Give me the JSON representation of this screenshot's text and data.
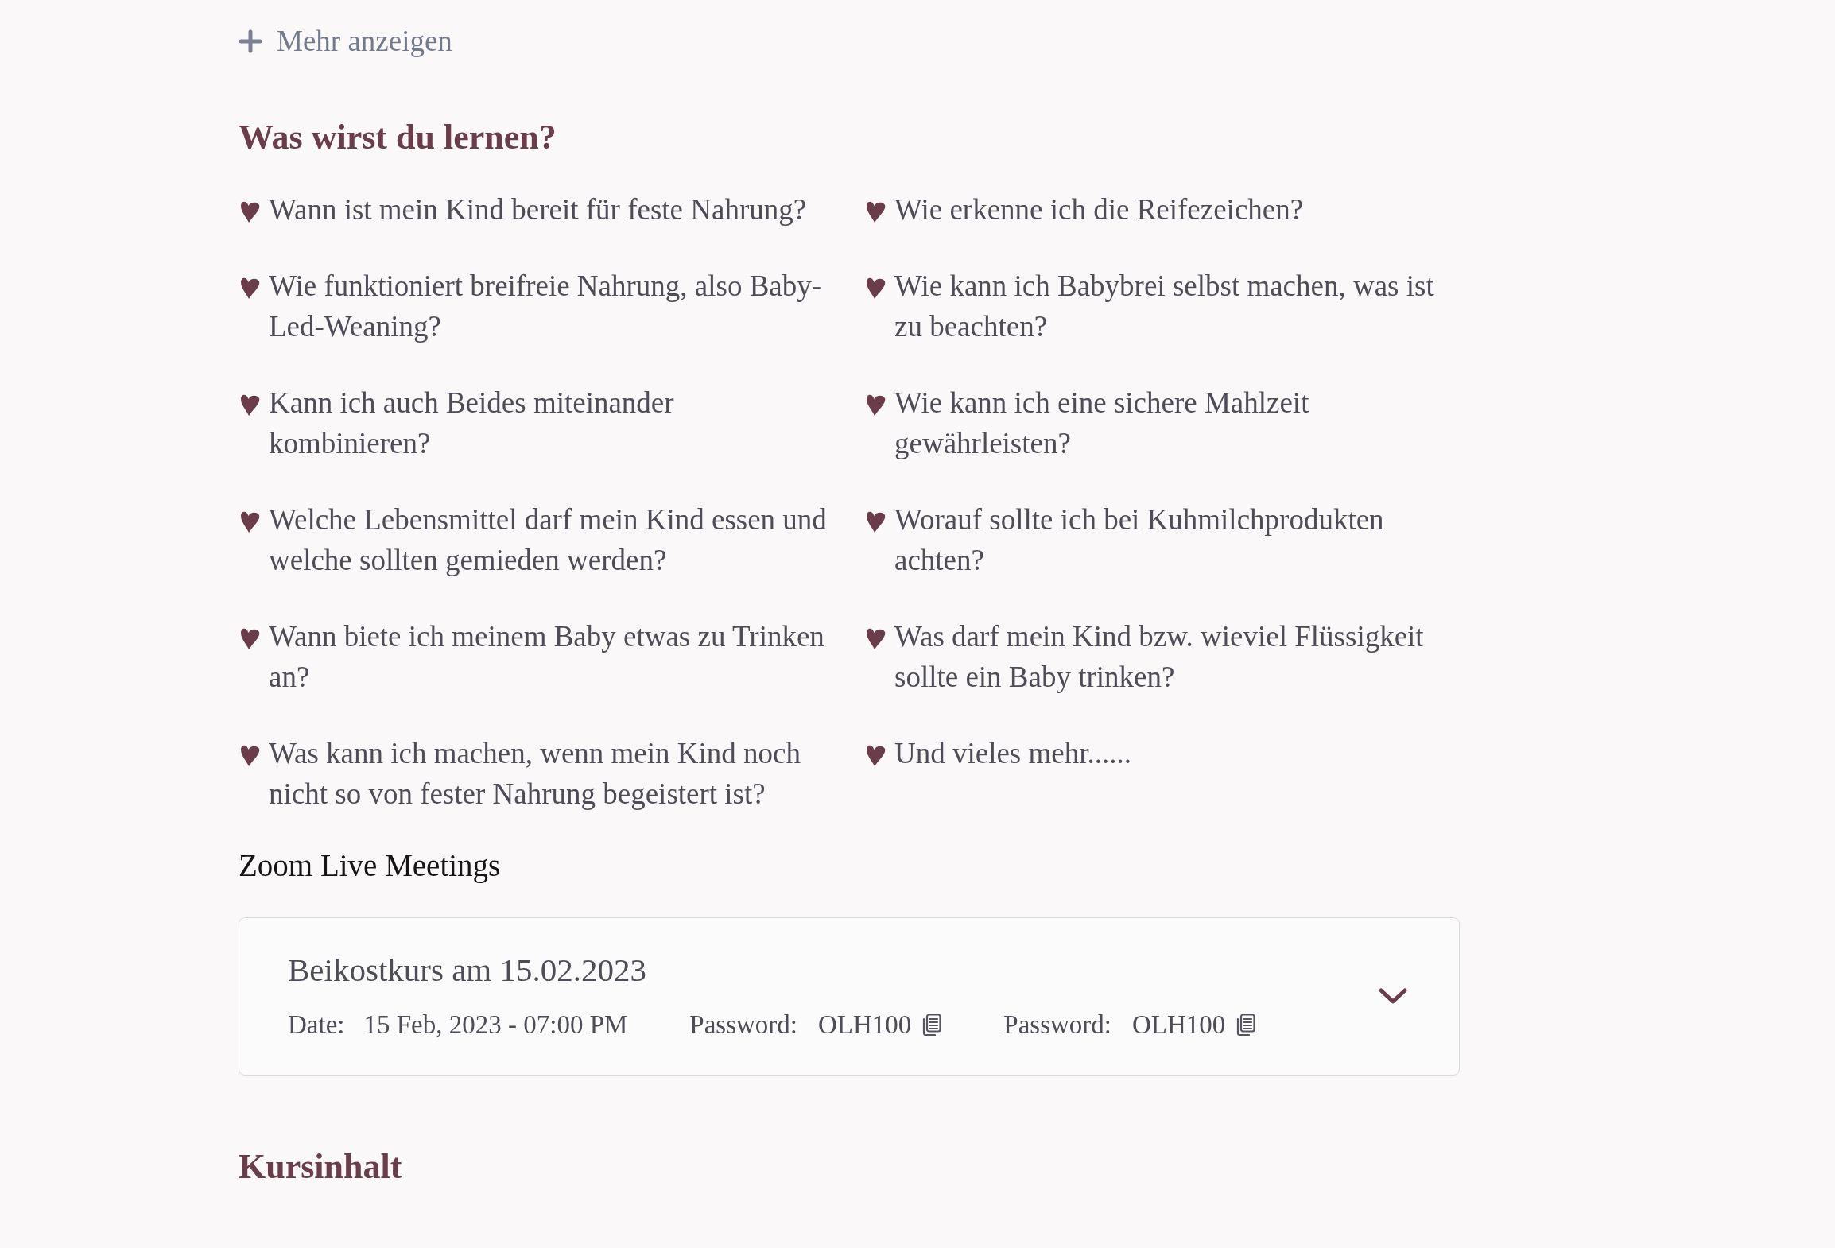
{
  "show_more": {
    "label": "Mehr anzeigen"
  },
  "learning": {
    "heading": "Was wirst du lernen?",
    "items": [
      "Wann ist mein Kind bereit für feste Nahrung?",
      "Wie erkenne ich die Reifezeichen?",
      "Wie funktioniert breifreie Nahrung, also Baby-Led-Weaning?",
      "Wie kann ich Babybrei selbst machen, was ist zu beachten?",
      "Kann ich auch Beides miteinander kombinieren?",
      "Wie kann ich eine sichere Mahlzeit gewährleisten?",
      "Welche Lebensmittel darf mein Kind essen und welche sollten gemieden werden?",
      "Worauf sollte ich bei Kuhmilchprodukten achten?",
      "Wann biete ich meinem Baby etwas zu Trinken an?",
      "Was darf mein Kind bzw. wieviel Flüssigkeit sollte ein Baby trinken?",
      "Was kann ich machen, wenn mein Kind noch nicht so von fester Nahrung begeistert ist?",
      "Und vieles mehr......"
    ]
  },
  "zoom_meetings": {
    "heading": "Zoom Live Meetings",
    "meetings": [
      {
        "title": "Beikostkurs am 15.02.2023",
        "expanded": false,
        "date_label": "Date:",
        "date": "15 Feb, 2023 - 07:00 PM",
        "passwords": [
          {
            "label": "Password:",
            "value": "OLH100"
          },
          {
            "label": "Password:",
            "value": "OLH100"
          }
        ]
      }
    ]
  },
  "course_content": {
    "heading": "Kursinhalt"
  }
}
